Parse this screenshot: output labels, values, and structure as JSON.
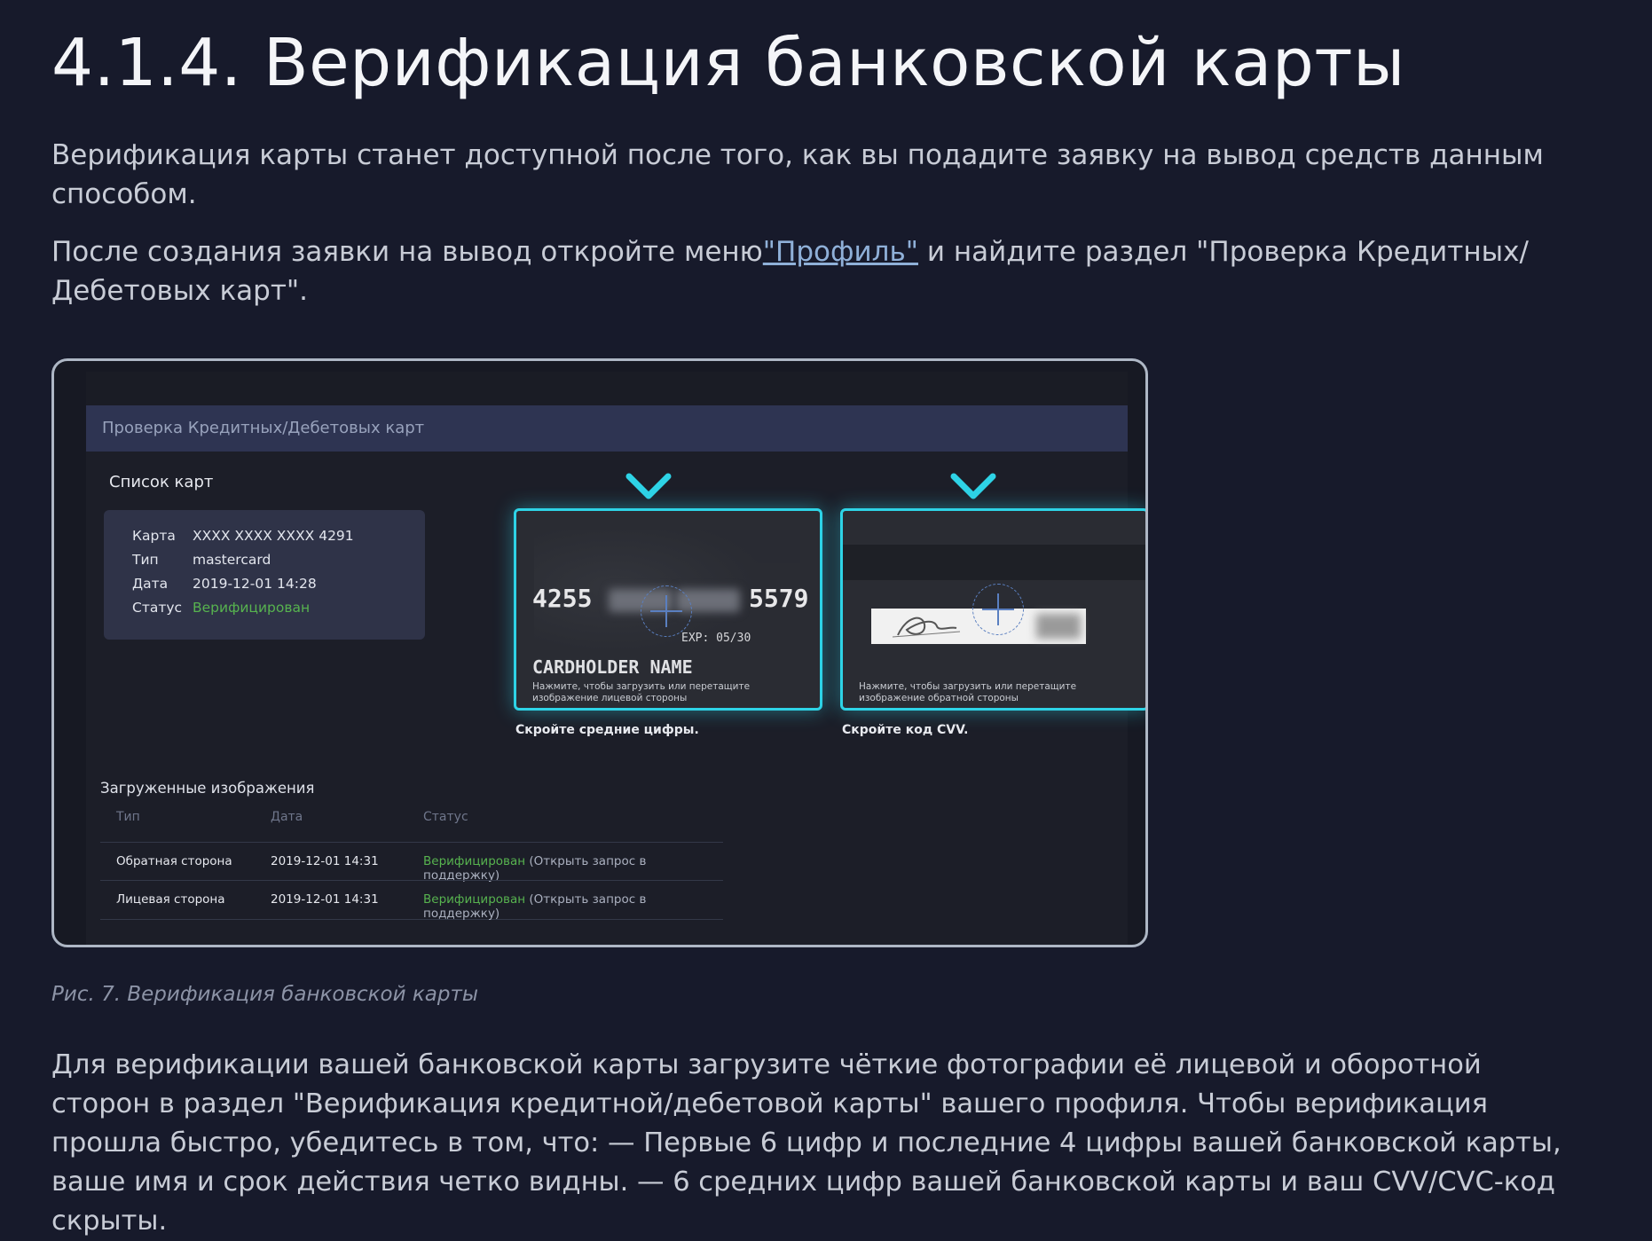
{
  "heading": "4.1.4. Верификация банковской карты",
  "para1": "Верификация карты станет доступной после того, как вы подадите заявку на вывод средств данным способом.",
  "para2": {
    "before": "После создания заявки на вывод откройте меню",
    "link": "\"Профиль\"",
    "after": " и найдите раздел \"Проверка Кредитных/ Дебетовых карт\"."
  },
  "figure": {
    "header": "Проверка Кредитных/Дебетовых карт",
    "cards_list_title": "Список карт",
    "card_info": {
      "card_label": "Карта",
      "card_value": "XXXX XXXX XXXX 4291",
      "type_label": "Тип",
      "type_value": "mastercard",
      "date_label": "Дата",
      "date_value": "2019-12-01 14:28",
      "status_label": "Статус",
      "status_value": "Верифицирован"
    },
    "front": {
      "num_first": "4255",
      "num_last": "5579",
      "exp": "EXP: 05/30",
      "holder": "CARDHOLDER NAME",
      "hint": "Нажмите, чтобы загрузить или перетащите изображение лицевой стороны",
      "caption": "Скройте средние цифры."
    },
    "back": {
      "hint": "Нажмите, чтобы загрузить или перетащите изображение обратной стороны",
      "caption": "Скройте код CVV."
    },
    "uploaded_title": "Загруженные изображения",
    "table": {
      "headers": [
        "Тип",
        "Дата",
        "Статус"
      ],
      "rows": [
        {
          "type": "Обратная сторона",
          "date": "2019-12-01 14:31",
          "status": "Верифицирован",
          "note": " (Открыть запрос в поддержку)"
        },
        {
          "type": "Лицевая сторона",
          "date": "2019-12-01 14:31",
          "status": "Верифицирован",
          "note": " (Открыть запрос в поддержку)"
        }
      ]
    }
  },
  "figure_caption": "Рис. 7. Верификация банковской карты",
  "para3": "Для верификации вашей банковской карты загрузите чёткие фотографии её лицевой и оборотной сторон в раздел \"Верификация кредитной/дебетовой карты\" вашего профиля. Чтобы верификация прошла быстро, убедитесь в том, что: — Первые 6 цифр и последние 4 цифры вашей банковской карты, ваше имя и срок действия четко видны. — 6 средних цифр вашей банковской карты и ваш CVV/CVC-код скрыты.",
  "colors": {
    "background": "#171a2b",
    "accent_glow": "#2ed3e6",
    "status_green": "#57b34f",
    "link": "#8fb0d8"
  }
}
